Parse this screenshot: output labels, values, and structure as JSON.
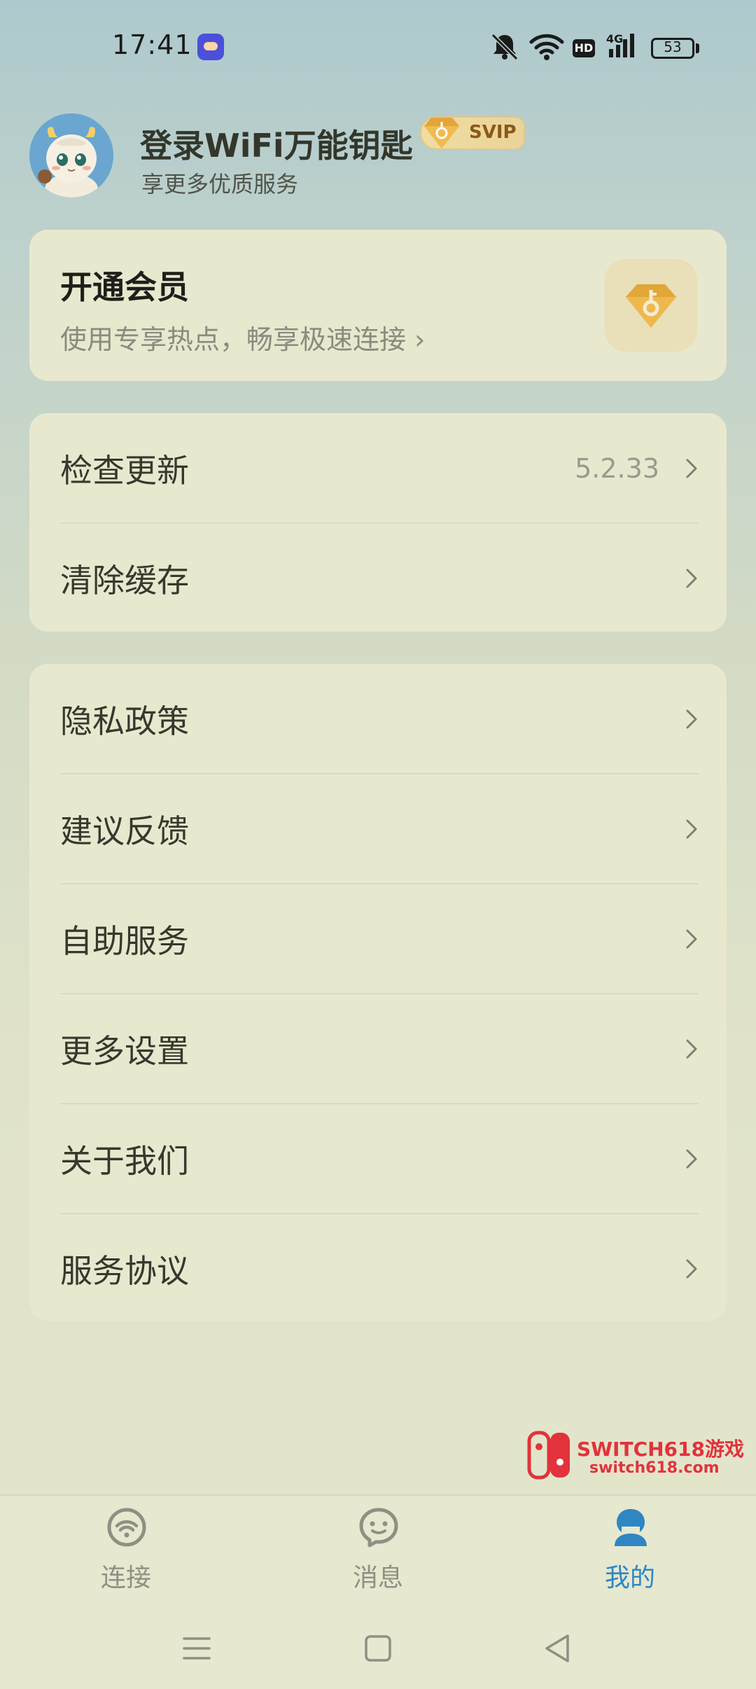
{
  "status_bar": {
    "time": "17:41",
    "network_type": "4G",
    "hd_label": "HD",
    "battery": "53"
  },
  "profile": {
    "title": "登录WiFi万能钥匙",
    "badge": "SVIP",
    "subtitle": "享更多优质服务"
  },
  "vip_card": {
    "title": "开通会员",
    "subtitle": "使用专享热点，畅享极速连接 ›"
  },
  "group1": [
    {
      "label": "检查更新",
      "value": "5.2.33"
    },
    {
      "label": "清除缓存",
      "value": ""
    }
  ],
  "group2": [
    {
      "label": "隐私政策"
    },
    {
      "label": "建议反馈"
    },
    {
      "label": "自助服务"
    },
    {
      "label": "更多设置"
    },
    {
      "label": "关于我们"
    },
    {
      "label": "服务协议"
    }
  ],
  "watermark": {
    "title": "SWITCH618游戏",
    "domain": "switch618.com"
  },
  "bottom_nav": {
    "tabs": [
      {
        "label": "连接",
        "icon": "wifi-icon"
      },
      {
        "label": "消息",
        "icon": "message-icon"
      },
      {
        "label": "我的",
        "icon": "profile-icon",
        "active": true
      }
    ]
  },
  "colors": {
    "accent": "#2f86c3",
    "card": "#e8e8cf",
    "svip_gold": "#e9d296"
  }
}
